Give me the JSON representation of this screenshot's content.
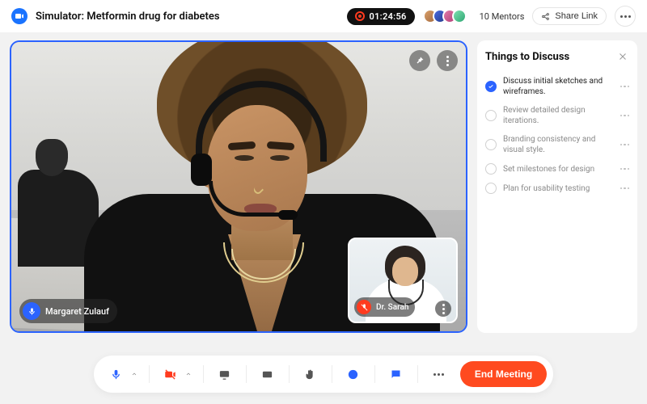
{
  "header": {
    "title": "Simulator: Metformin drug for diabetes",
    "recording_time": "01:24:56",
    "mentors_label": "10 Mentors",
    "share_label": "Share Link"
  },
  "stage": {
    "primary_participant": "Margaret Zulauf",
    "primary_mic_on": true,
    "pip_participant": "Dr. Sarah",
    "pip_mic_on": false
  },
  "sidebar": {
    "title": "Things to Discuss",
    "items": [
      {
        "text": "Discuss initial sketches and wireframes.",
        "done": true
      },
      {
        "text": "Review detailed design iterations.",
        "done": false
      },
      {
        "text": "Branding consistency and visual style.",
        "done": false
      },
      {
        "text": "Set milestones for design",
        "done": false
      },
      {
        "text": "Plan for usability testing",
        "done": false
      }
    ]
  },
  "dock": {
    "end_label": "End Meeting"
  },
  "colors": {
    "accent": "#2b63ff",
    "danger": "#ff3b1f"
  }
}
